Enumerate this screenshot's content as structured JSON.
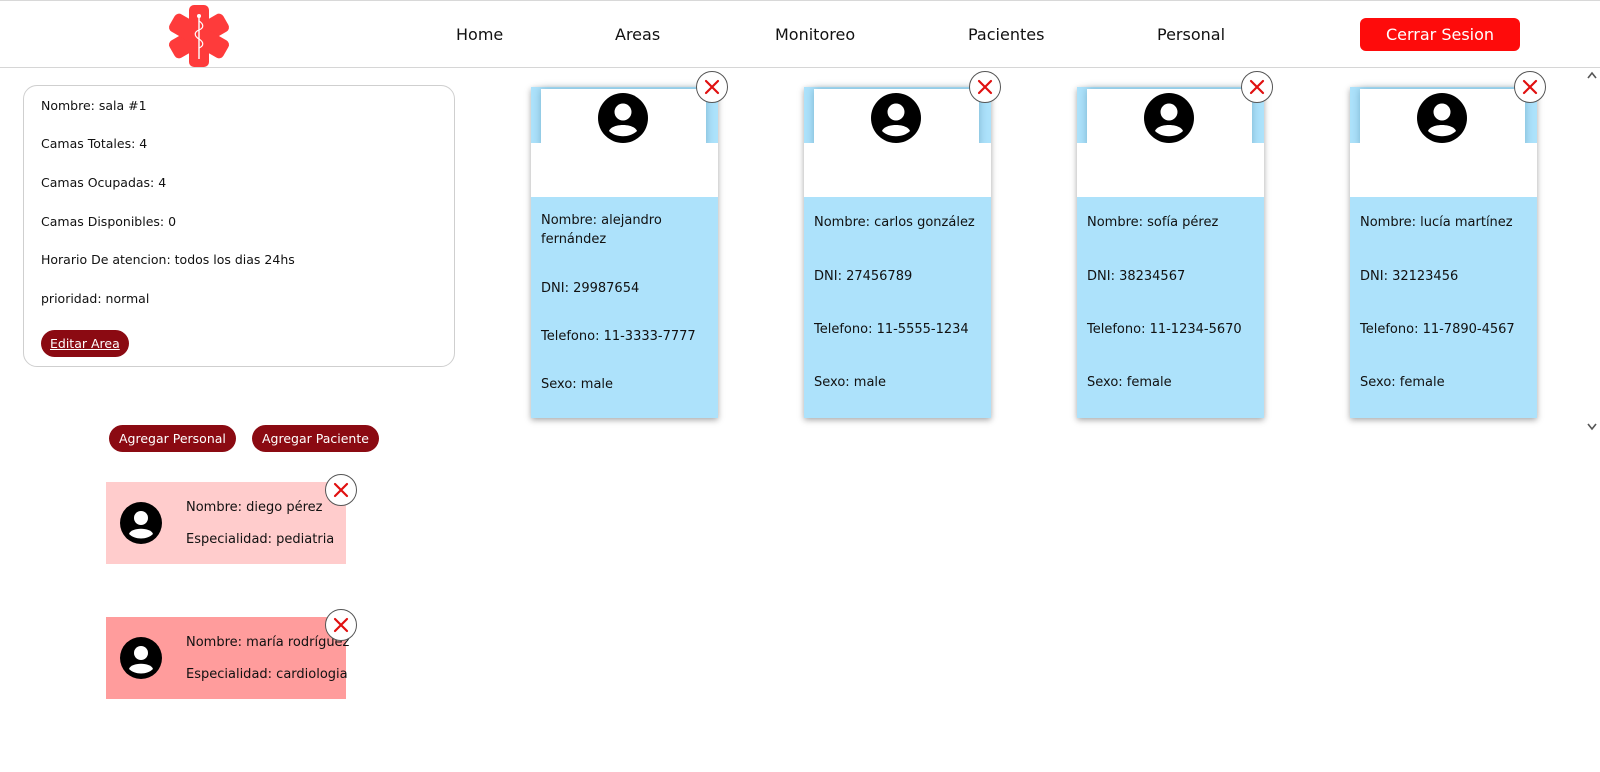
{
  "header": {
    "logo_icon": "medical-star-of-life-icon",
    "brand_color": "#fe3b3b",
    "nav": [
      {
        "label": "Home"
      },
      {
        "label": "Areas"
      },
      {
        "label": "Monitoreo"
      },
      {
        "label": "Pacientes"
      },
      {
        "label": "Personal"
      }
    ],
    "logout_label": "Cerrar Sesion",
    "logout_color": "#fe0b0b"
  },
  "area": {
    "nombre": "Nombre: sala #1",
    "camas_totales": "Camas Totales: 4",
    "camas_ocupadas": "Camas Ocupadas: 4",
    "camas_disponibles": "Camas Disponibles: 0",
    "horario": "Horario De atencion: todos los dias 24hs",
    "prioridad": "prioridad: normal",
    "edit_label": "Editar Area"
  },
  "actions": {
    "add_staff_label": "Agregar Personal",
    "add_patient_label": "Agregar Paciente",
    "button_color": "#8b0a12"
  },
  "staff": [
    {
      "nombre": "Nombre: diego pérez",
      "especialidad": "Especialidad: pediatria",
      "color": "#ffcccc"
    },
    {
      "nombre": "Nombre: maría rodríguez",
      "especialidad": "Especialidad: cardiologia",
      "color": "#ff9c9c"
    }
  ],
  "patients": [
    {
      "nombre": "Nombre: alejandro fernández",
      "dni": "DNI: 29987654",
      "telefono": "Telefono: 11-3333-7777",
      "sexo": "Sexo: male"
    },
    {
      "nombre": "Nombre: carlos gonzález",
      "dni": "DNI: 27456789",
      "telefono": "Telefono: 11-5555-1234",
      "sexo": "Sexo: male"
    },
    {
      "nombre": "Nombre: sofía pérez",
      "dni": "DNI: 38234567",
      "telefono": "Telefono: 11-1234-5670",
      "sexo": "Sexo: female"
    },
    {
      "nombre": "Nombre: lucía martínez",
      "dni": "DNI: 32123456",
      "telefono": "Telefono: 11-7890-4567",
      "sexo": "Sexo: female"
    }
  ],
  "patient_card_color": "#ade2fb"
}
